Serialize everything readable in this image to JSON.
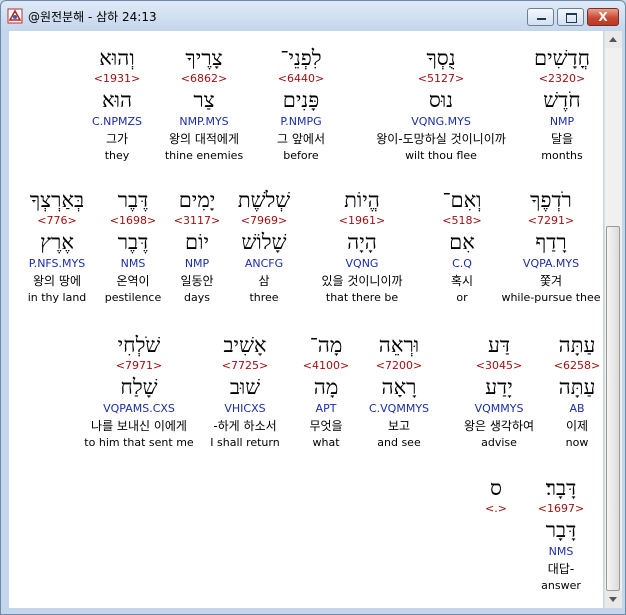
{
  "window": {
    "title": "@원전분해 - 삼하 24:13",
    "icon": "app-logo-icon",
    "min_icon": "minimize-icon",
    "max_icon": "maximize-icon",
    "close_icon": "close-icon",
    "close_glyph": "X"
  },
  "colors": {
    "strong": "#a01010",
    "morph": "#1a2ea8"
  },
  "rows": [
    {
      "words": [
        {
          "heb": "חֳדָשִׁים",
          "sn": "<2320>",
          "lex": "חֹדֶשׁ",
          "morph": "NMP",
          "ko": "달을",
          "en": "months"
        },
        {
          "heb": "נֻסְךָ",
          "sn": "<5127>",
          "lex": "נוּס",
          "morph": "VQNG.MYS",
          "ko": "왕이-도망하실 것이니이까",
          "en": "wilt thou flee"
        },
        {
          "heb": "לִפְנֵי־",
          "sn": "<6440>",
          "lex": "פָּנִים",
          "morph": "P.NMPG",
          "ko": "그 앞에서",
          "en": "before"
        },
        {
          "heb": "צָרֶיךָ",
          "sn": "<6862>",
          "lex": "צַר",
          "morph": "NMP.MYS",
          "ko": "왕의 대적에게",
          "en": "thine enemies"
        },
        {
          "heb": "וְהוּא",
          "sn": "<1931>",
          "lex": "הוּא",
          "morph": "C.NPMZS",
          "ko": "그가",
          "en": "they"
        }
      ]
    },
    {
      "words": [
        {
          "heb": "רֹדְפֶךָ",
          "sn": "<7291>",
          "lex": "רָדַף",
          "morph": "VQPA.MYS",
          "ko": "쫓겨",
          "en": "while-pursue thee"
        },
        {
          "heb": "וְאִם־",
          "sn": "<518>",
          "lex": "אִם",
          "morph": "C.Q",
          "ko": "혹시",
          "en": "or"
        },
        {
          "heb": "הֱיוֹת",
          "sn": "<1961>",
          "lex": "הָיָה",
          "morph": "VQNG",
          "ko": "있을 것이니이까",
          "en": "that there be"
        },
        {
          "heb": "שְׁלֹשֶׁת",
          "sn": "<7969>",
          "lex": "שָׁלוֹשׁ",
          "morph": "ANCFG",
          "ko": "삼",
          "en": "three"
        },
        {
          "heb": "יָמִים",
          "sn": "<3117>",
          "lex": "יוֹם",
          "morph": "NMP",
          "ko": "일동안",
          "en": "days"
        },
        {
          "heb": "דֶּבֶר",
          "sn": "<1698>",
          "lex": "דֶּבֶר",
          "morph": "NMS",
          "ko": "온역이",
          "en": "pestilence"
        },
        {
          "heb": "בְּאַרְצְךָ",
          "sn": "<776>",
          "lex": "אֶרֶץ",
          "morph": "P.NFS.MYS",
          "ko": "왕의 땅에",
          "en": "in thy land"
        }
      ]
    },
    {
      "words": [
        {
          "heb": "עַתָּה",
          "sn": "<6258>",
          "lex": "עַתָּה",
          "morph": "AB",
          "ko": "이제",
          "en": "now"
        },
        {
          "heb": "דַּע",
          "sn": "<3045>",
          "lex": "יָדַע",
          "morph": "VQMMYS",
          "ko": "왕은 생각하여",
          "en": "advise"
        },
        {
          "heb": "וּרְאֵה",
          "sn": "<7200>",
          "lex": "רָאָה",
          "morph": "C.VQMMYS",
          "ko": "보고",
          "en": "and see"
        },
        {
          "heb": "מָה־",
          "sn": "<4100>",
          "lex": "מָה",
          "morph": "APT",
          "ko": "무엇을",
          "en": "what"
        },
        {
          "heb": "אָשִׁיב",
          "sn": "<7725>",
          "lex": "שׁוּב",
          "morph": "VHICXS",
          "ko": "-하게 하소서",
          "en": "I shall return"
        },
        {
          "heb": "שֹׁלְחִי",
          "sn": "<7971>",
          "lex": "שָׁלַח",
          "morph": "VQPAMS.CXS",
          "ko": "나를 보내신 이에게",
          "en": "to him that sent me"
        }
      ]
    },
    {
      "words": [
        {
          "heb": "דָּבָר׃",
          "sn": "<1697>",
          "lex": "דָּבָר",
          "morph": "NMS",
          "ko": "대답-",
          "en": "answer"
        },
        {
          "heb": "ס",
          "sn": "<.>",
          "lex": "",
          "morph": "",
          "ko": "",
          "en": ""
        }
      ]
    }
  ]
}
